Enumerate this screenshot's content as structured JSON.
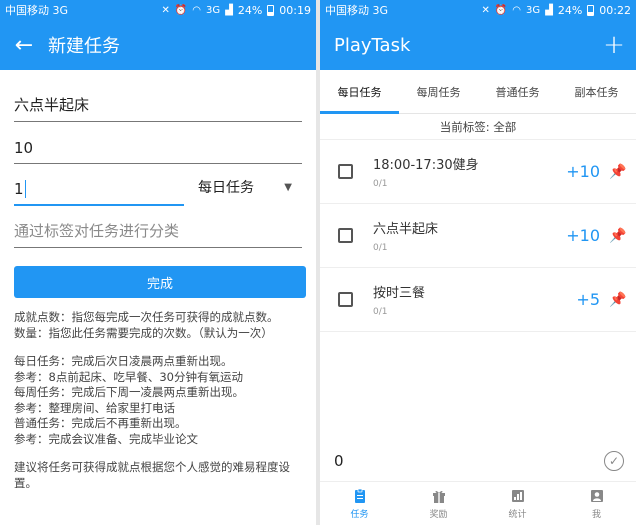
{
  "left": {
    "status": {
      "carrier": "中国移动 3G",
      "signal_type": "3G",
      "battery": "24%",
      "time": "00:19"
    },
    "appbar": {
      "title": "新建任务"
    },
    "form": {
      "name_value": "六点半起床",
      "points_value": "10",
      "count_value": "1",
      "type_selected": "每日任务",
      "tag_placeholder": "通过标签对任务进行分类",
      "done_label": "完成"
    },
    "help": [
      "成就点数：指您每完成一次任务可获得的成就点数。",
      "数量：指您此任务需要完成的次数。（默认为一次）",
      "",
      "每日任务：完成后次日凌晨两点重新出现。",
      "参考：8点前起床、吃早餐、30分钟有氧运动",
      "每周任务：完成后下周一凌晨两点重新出现。",
      "参考：整理房间、给家里打电话",
      "普通任务：完成后不再重新出现。",
      "参考：完成会议准备、完成毕业论文",
      "",
      "建议将任务可获得成就点根据您个人感觉的难易程度设置。"
    ]
  },
  "right": {
    "status": {
      "carrier": "中国移动 3G",
      "signal_type": "3G",
      "battery": "24%",
      "time": "00:22"
    },
    "appbar": {
      "title": "PlayTask",
      "add_label": "+"
    },
    "tabs": [
      "每日任务",
      "每周任务",
      "普通任务",
      "副本任务"
    ],
    "current_tag": "当前标签: 全部",
    "tasks": [
      {
        "name": "18:00-17:30健身",
        "count": "0/1",
        "points": "+10"
      },
      {
        "name": "六点半起床",
        "count": "0/1",
        "points": "+10"
      },
      {
        "name": "按时三餐",
        "count": "0/1",
        "points": "+5"
      }
    ],
    "total": "0",
    "nav": [
      "任务",
      "奖励",
      "统计",
      "我"
    ]
  },
  "colors": {
    "primary": "#2196f3"
  },
  "icons": [
    "back-arrow-icon",
    "add-icon",
    "pin-icon",
    "check-circle-icon",
    "clipboard-icon",
    "gift-icon",
    "bar-chart-icon",
    "person-icon"
  ]
}
